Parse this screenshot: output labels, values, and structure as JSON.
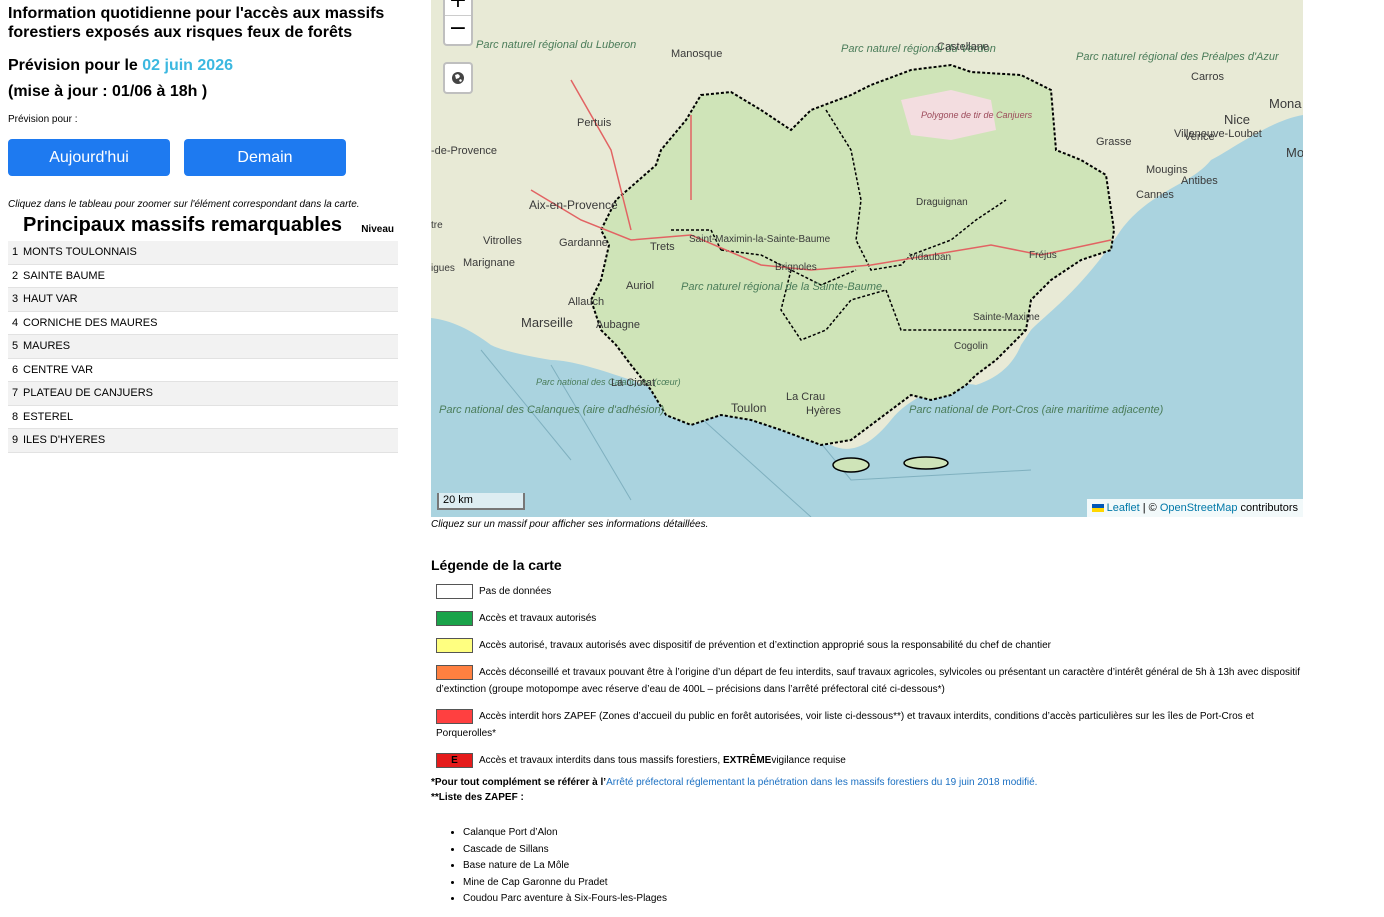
{
  "header": {
    "title": "Information quotidienne pour l'accès aux massifs forestiers exposés aux risques feux de forêts",
    "forecast_prefix": "Prévision pour le",
    "forecast_date": "02 juin 2026",
    "update": "(mise à jour : 01/06 à 18h )",
    "forecast_label": "Prévision pour :"
  },
  "buttons": {
    "today": "Aujourd'hui",
    "tomorrow": "Demain"
  },
  "table": {
    "hint": "Cliquez dans le tableau pour zoomer sur l'élément correspondant dans la carte.",
    "title": "Principaux massifs remarquables",
    "level_header": "Niveau",
    "rows": [
      {
        "num": "1",
        "name": "MONTS TOULONNAIS"
      },
      {
        "num": "2",
        "name": "SAINTE BAUME"
      },
      {
        "num": "3",
        "name": "HAUT VAR"
      },
      {
        "num": "4",
        "name": "CORNICHE DES MAURES"
      },
      {
        "num": "5",
        "name": "MAURES"
      },
      {
        "num": "6",
        "name": "CENTRE VAR"
      },
      {
        "num": "7",
        "name": "PLATEAU DE CANJUERS"
      },
      {
        "num": "8",
        "name": "ESTEREL"
      },
      {
        "num": "9",
        "name": "ILES D'HYERES"
      }
    ]
  },
  "map": {
    "zoom_in": "+",
    "zoom_out": "−",
    "scale": "20 km",
    "attribution": {
      "leaflet": "Leaflet",
      "sep": " | © ",
      "osm": "OpenStreetMap",
      "suffix": " contributors"
    },
    "hint": "Cliquez sur un massif pour afficher ses informations détaillées.",
    "labels": {
      "luberon": "Parc naturel régional du Luberon",
      "verdon": "Parc naturel régional du Verdon",
      "prealpes": "Parc naturel régional des Préalpes d'Azur",
      "canjuers": "Polygone de tir de Canjuers",
      "sainte_baume": "Parc naturel régional de la Sainte-Baume",
      "calanques_coeur": "Parc national des Calanques (cœur)",
      "calanques_adh": "Parc national des Calanques (aire d'adhésion)",
      "port_cros": "Parc national de Port-Cros (aire maritime adjacente)",
      "manosque": "Manosque",
      "castellane": "Castellane",
      "carros": "Carros",
      "nice": "Nice",
      "monaco": "Mona",
      "mo": "Mo",
      "vence": "Vence",
      "villeneuve": "Villeneuve-Loubet",
      "grasse": "Grasse",
      "mougins": "Mougins",
      "antibes": "Antibes",
      "cannes": "Cannes",
      "pertuis": "Pertuis",
      "provence": "-de-Provence",
      "aix": "Aix-en-Provence",
      "vitrolles": "Vitrolles",
      "gardanne": "Gardanne",
      "trets": "Trets",
      "marignane": "Marignane",
      "aurjol": "Auriol",
      "allauch": "Allauch",
      "marseille": "Marseille",
      "aubagne": "Aubagne",
      "laciotat": "La Ciotat",
      "toulon": "Toulon",
      "lacrau": "La Crau",
      "hyeres": "Hyères",
      "stmax": "Saint-Maximin-la-Sainte-Baume",
      "brignoles": "Brignoles",
      "vidauban": "Vidauban",
      "draguignan": "Draguignan",
      "frejus": "Fréjus",
      "stemaxime": "Sainte-Maxime",
      "cogolin": "Cogolin",
      "tre": "tre",
      "igues": "igues"
    }
  },
  "legend": {
    "title": "Légende de la carte",
    "items": [
      {
        "color": "#ffffff",
        "mark": "",
        "text": "Pas de données"
      },
      {
        "color": "#1aa34a",
        "mark": "",
        "text": "Accès et travaux autorisés"
      },
      {
        "color": "#ffff80",
        "mark": "",
        "text": "Accès autorisé, travaux autorisés avec dispositif de prévention et d’extinction approprié sous la responsabilité du chef de chantier"
      },
      {
        "color": "#ff8040",
        "mark": "",
        "text": "Accès déconseillé et travaux pouvant être à l’origine d’un départ de feu interdits, sauf travaux agricoles, sylvicoles ou présentant un caractère d’intérêt général de 5h à 13h avec dispositif d’extinction (groupe motopompe avec réserve d’eau de 400L – précisions dans l’arrêté préfectoral cité ci-dessous*)"
      },
      {
        "color": "#ff4040",
        "mark": "",
        "text": "Accès interdit hors ZAPEF (Zones d’accueil du public en forêt autorisées, voir liste ci-dessous**) et travaux interdits, conditions d’accès particulières sur les îles de Port-Cros et Porquerolles*"
      },
      {
        "color": "#e51b1b",
        "mark": "E",
        "text": "Accès et travaux interdits dans tous massifs forestiers, ",
        "strong": "EXTRÊME",
        "text_after": "vigilance requise"
      }
    ],
    "note_prefix": "*Pour tout complément se référer à l’",
    "note_link": "Arrêté préfectoral réglementant la pénétration dans les massifs forestiers du 19 juin 2018 modifié.",
    "zapef_label": "**Liste des ZAPEF :",
    "zapef": [
      "Calanque Port d’Alon",
      "Cascade de Sillans",
      "Base nature de La Môle",
      "Mine de Cap Garonne du Pradet",
      "Coudou Parc aventure à Six-Fours-les-Plages"
    ]
  }
}
